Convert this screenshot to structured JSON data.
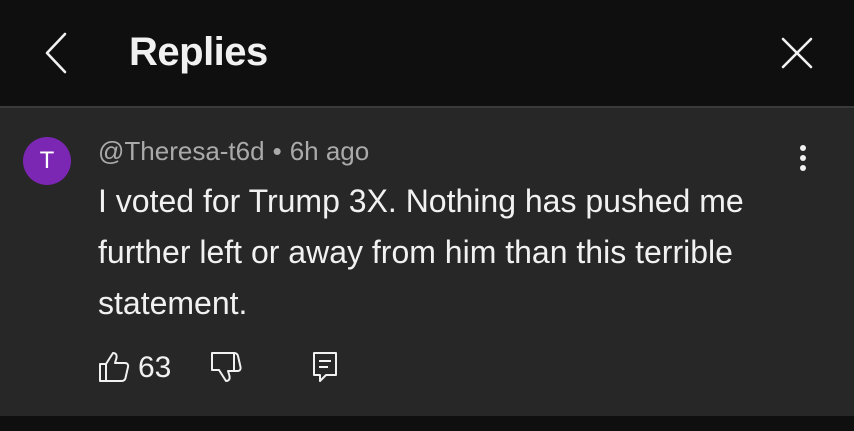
{
  "header": {
    "title": "Replies",
    "back_icon": "chevron-left-icon",
    "close_icon": "close-icon"
  },
  "comment": {
    "avatar_letter": "T",
    "avatar_color": "#7b27b3",
    "author": "@Theresa-t6d",
    "separator": "•",
    "time": "6h ago",
    "text": "I voted for Trump 3X. Nothing has pushed me further left or away from him than this terrible statement.",
    "like_count": "63",
    "icons": {
      "like": "thumbs-up-icon",
      "dislike": "thumbs-down-icon",
      "reply": "reply-icon",
      "more": "more-vert-icon"
    }
  },
  "colors": {
    "background": "#0f0f0f",
    "card": "#272727",
    "text": "#f1f1f1",
    "meta": "#aaaaaa"
  }
}
